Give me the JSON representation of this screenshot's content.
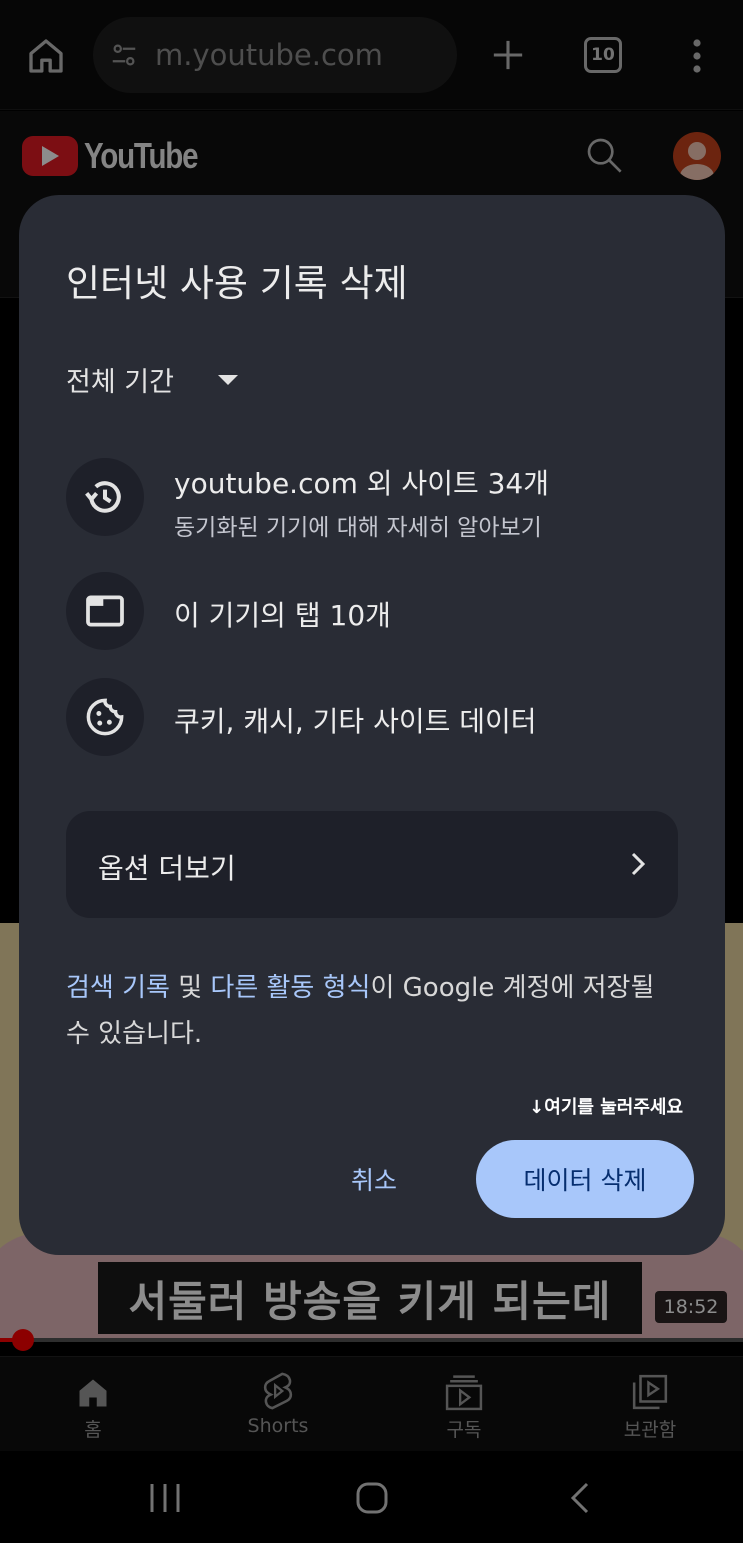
{
  "browser": {
    "url": "m.youtube.com",
    "tab_count": "10",
    "icons": [
      "home-icon",
      "site-settings-icon",
      "plus-icon",
      "tabs-icon",
      "more-vert-icon"
    ]
  },
  "youtube": {
    "logo_text": "YouTube",
    "icons": [
      "search-icon",
      "account-icon"
    ],
    "caption_text": "서둘러 방송을 키게 되는데",
    "duration": "18:52",
    "progress_fraction": 0.02,
    "bottom_nav": [
      {
        "label": "홈",
        "icon": "home-filled-icon"
      },
      {
        "label": "Shorts",
        "icon": "shorts-icon"
      },
      {
        "label": "구독",
        "icon": "subscriptions-icon"
      },
      {
        "label": "보관함",
        "icon": "library-icon"
      }
    ]
  },
  "dialog": {
    "title": "인터넷 사용 기록 삭제",
    "time_range": "전체 기간",
    "items": [
      {
        "title": "youtube.com 외 사이트 34개",
        "subtitle": "동기화된 기기에 대해 자세히 알아보기",
        "icon": "history-icon"
      },
      {
        "title": "이 기기의 탭 10개",
        "icon": "tab-icon"
      },
      {
        "title": "쿠키, 캐시, 기타 사이트 데이터",
        "icon": "cookie-icon"
      }
    ],
    "more_options": "옵션 더보기",
    "notice": {
      "link1": "검색 기록",
      "text1": " 및 ",
      "link2": "다른 활동 형식",
      "text2": "이 Google 계정에 저장될 수 있습니다."
    },
    "hint": "↓여기를 눌러주세요",
    "cancel": "취소",
    "delete": "데이터 삭제"
  },
  "colors": {
    "dialog_bg": "#292c35",
    "accent": "#a8c7fa",
    "youtube_red": "#e21b23"
  }
}
